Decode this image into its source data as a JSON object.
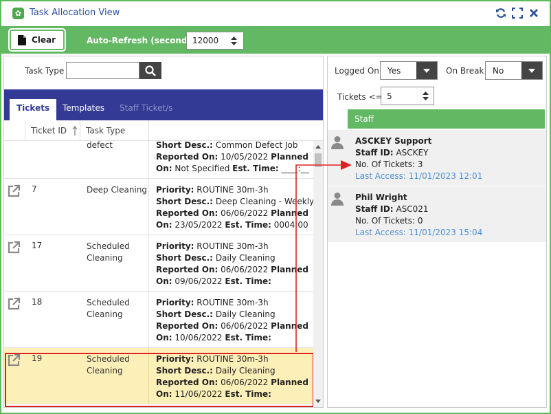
{
  "window": {
    "title": "Task Allocation View"
  },
  "toolbar": {
    "clear_label": "Clear",
    "auto_refresh_label": "Auto-Refresh (seconds)",
    "auto_refresh_value": "12000"
  },
  "search": {
    "task_type_label": "Task Type",
    "task_type_value": ""
  },
  "tabs": [
    "Tickets",
    "Templates",
    "Staff Ticket/s"
  ],
  "columns": {
    "ticket_id": "Ticket ID",
    "task_type": "Task Type"
  },
  "tickets": [
    {
      "id": "",
      "type": "defect",
      "priority": "",
      "short_desc": "Common Defect Job",
      "reported_on": "10/05/2022",
      "planned_on": "Not Specified",
      "est_time": "____:__"
    },
    {
      "id": "7",
      "type": "Deep Cleaning",
      "priority": "ROUTINE 30m-3h",
      "short_desc": "Deep Cleaning - Weekly",
      "reported_on": "06/06/2022",
      "planned_on": "23/05/2022",
      "est_time": "0004:00"
    },
    {
      "id": "17",
      "type": "Scheduled Cleaning",
      "priority": "ROUTINE 30m-3h",
      "short_desc": "Daily Cleaning",
      "reported_on": "06/06/2022",
      "planned_on": "09/06/2022",
      "est_time": ""
    },
    {
      "id": "18",
      "type": "Scheduled Cleaning",
      "priority": "ROUTINE 30m-3h",
      "short_desc": "Daily Cleaning",
      "reported_on": "06/06/2022",
      "planned_on": "10/06/2022",
      "est_time": ""
    },
    {
      "id": "19",
      "type": "Scheduled Cleaning",
      "priority": "ROUTINE 30m-3h",
      "short_desc": "Daily Cleaning",
      "reported_on": "06/06/2022",
      "planned_on": "11/06/2022",
      "est_time": ""
    }
  ],
  "labels": {
    "priority": "Priority:",
    "short_desc": "Short Desc.:",
    "reported_on": "Reported On:",
    "planned": "Planned",
    "on": "On:",
    "est_time": "Est. Time:",
    "staff_id": "Staff ID:",
    "no_of_tickets": "No. Of Tickets:",
    "last_access": "Last Access:"
  },
  "filters": {
    "logged_on_label": "Logged On",
    "logged_on_value": "Yes",
    "on_break_label": "On Break",
    "on_break_value": "No",
    "tickets_label": "Tickets <=",
    "tickets_value": "5"
  },
  "staff_header": "Staff",
  "staff": [
    {
      "name": "ASCKEY Support",
      "staff_id": "ASCKEY",
      "tickets": "3",
      "last_access": "11/01/2023 12:01"
    },
    {
      "name": "Phil Wright",
      "staff_id": "ASC021",
      "tickets": "0",
      "last_access": "11/01/2023 15:04"
    }
  ],
  "colors": {
    "green": "#63b863",
    "tab_bar": "#323a96",
    "highlight_row": "#fcefb8",
    "highlight_border": "#e02020",
    "link_blue": "#4f8fd6"
  }
}
